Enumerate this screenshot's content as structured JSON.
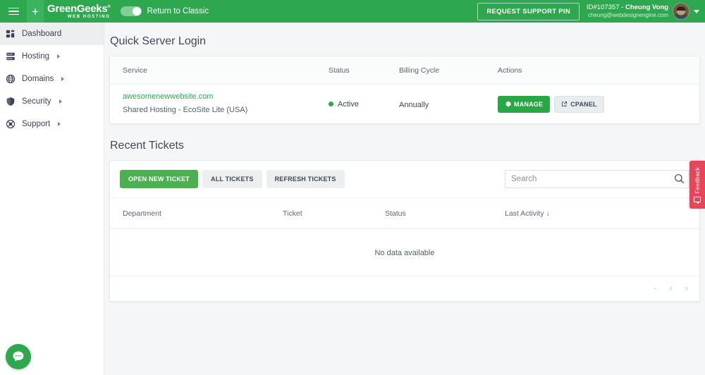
{
  "header": {
    "menu_icon": "hamburger-icon",
    "plus_icon": "plus-icon",
    "brand_name": "GreenGeeks",
    "brand_tagline": "WEB HOSTING",
    "toggle_label": "Return to Classic",
    "toggle_state": "on",
    "support_pin_label": "REQUEST SUPPORT PIN",
    "user_id": "ID#107357 - ",
    "user_name": "Cheung Vong",
    "user_email": "cheung@webdesignengine.com",
    "avatar_icon": "user-avatar",
    "chevron_icon": "chevron-down-icon",
    "bg_color": "#2ea84f"
  },
  "sidebar": {
    "items": [
      {
        "label": "Dashboard",
        "icon": "dashboard-grid-icon",
        "active": true,
        "has_caret": false
      },
      {
        "label": "Hosting",
        "icon": "server-icon",
        "active": false,
        "has_caret": true
      },
      {
        "label": "Domains",
        "icon": "globe-icon",
        "active": false,
        "has_caret": true
      },
      {
        "label": "Security",
        "icon": "shield-icon",
        "active": false,
        "has_caret": true
      },
      {
        "label": "Support",
        "icon": "lifebuoy-icon",
        "active": false,
        "has_caret": true
      }
    ]
  },
  "quick_server_login": {
    "title": "Quick Server Login",
    "columns": [
      "Service",
      "Status",
      "Billing Cycle",
      "Actions"
    ],
    "rows": [
      {
        "domain": "awesomenewwebsite.com",
        "plan": "Shared Hosting - EcoSite Lite (USA)",
        "status": "Active",
        "status_color": "#2ea84f",
        "billing_cycle": "Annually",
        "actions": [
          {
            "label": "MANAGE",
            "icon": "gear-icon",
            "style": "primary"
          },
          {
            "label": "CPANEL",
            "icon": "external-link-icon",
            "style": "secondary"
          }
        ]
      }
    ]
  },
  "recent_tickets": {
    "title": "Recent Tickets",
    "buttons": [
      {
        "label": "OPEN NEW TICKET",
        "style": "primary"
      },
      {
        "label": "ALL TICKETS",
        "style": "light"
      },
      {
        "label": "REFRESH TICKETS",
        "style": "light"
      }
    ],
    "search": {
      "placeholder": "Search",
      "value": "",
      "icon": "search-icon"
    },
    "columns": [
      "Department",
      "Ticket",
      "Status",
      "Last Activity"
    ],
    "sort_column": "Last Activity",
    "sort_icon": "arrow-down-icon",
    "empty_message": "No data available",
    "pagination": {
      "range": "-",
      "prev_icon": "chevron-left-icon",
      "next_icon": "chevron-right-icon"
    }
  },
  "feedback_tab": {
    "label": "Feedback",
    "icon": "comment-icon",
    "color": "#e8445a"
  },
  "chat_widget": {
    "icon": "chat-bubble-icon",
    "color": "#2ea84f"
  }
}
